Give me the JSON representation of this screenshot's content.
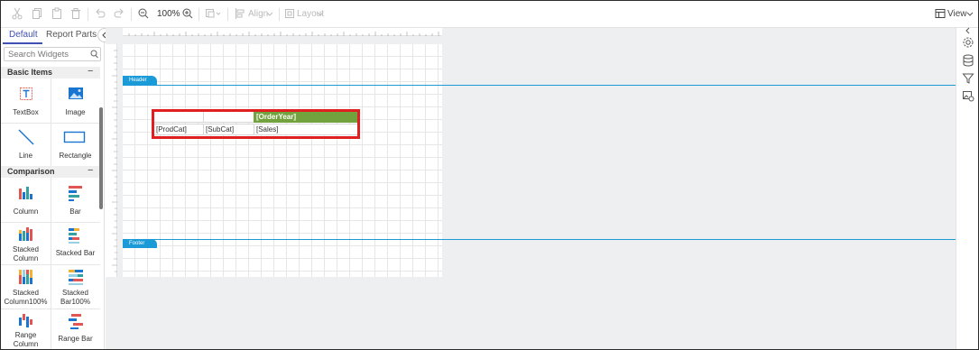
{
  "toolbar": {
    "cut_icon": "scissors-icon",
    "copy_icon": "copy-icon",
    "paste_icon": "paste-icon",
    "delete_icon": "trash-icon",
    "undo_icon": "undo-icon",
    "redo_icon": "redo-icon",
    "zoom_out_icon": "zoom-out-icon",
    "zoom_level": "100%",
    "zoom_in_icon": "zoom-in-icon",
    "align_label": "Align",
    "layout_label": "Layout",
    "view_label": "View"
  },
  "panel": {
    "tabs": [
      {
        "label": "Default",
        "active": true
      },
      {
        "label": "Report Parts",
        "active": false
      }
    ],
    "search": {
      "placeholder": "Search Widgets"
    },
    "sections": [
      {
        "title": "Basic Items",
        "toggle": "−",
        "items": [
          {
            "label": "TextBox",
            "icon": "textbox-icon"
          },
          {
            "label": "Image",
            "icon": "image-icon"
          },
          {
            "label": "Line",
            "icon": "line-icon"
          },
          {
            "label": "Rectangle",
            "icon": "rectangle-icon"
          }
        ]
      },
      {
        "title": "Comparison",
        "toggle": "−",
        "items": [
          {
            "label": "Column",
            "icon": "column-chart-icon"
          },
          {
            "label": "Bar",
            "icon": "bar-chart-icon"
          },
          {
            "label_line1": "Stacked",
            "label_line2": "Column",
            "icon": "stacked-column-icon"
          },
          {
            "label": "Stacked Bar",
            "icon": "stacked-bar-icon"
          },
          {
            "label_line1": "Stacked",
            "label_line2": "Column100%",
            "icon": "stacked-column-100-icon"
          },
          {
            "label_line1": "Stacked",
            "label_line2": "Bar100%",
            "icon": "stacked-bar-100-icon"
          },
          {
            "label_line1": "Range",
            "label_line2": "Column",
            "icon": "range-column-icon"
          },
          {
            "label": "Range Bar",
            "icon": "range-bar-icon"
          }
        ]
      }
    ]
  },
  "report": {
    "header_label": "Header",
    "footer_label": "Footer",
    "tablix": {
      "column_group": "[OrderYear]",
      "row_cells": [
        "[ProdCat]",
        "[SubCat]",
        "[Sales]"
      ]
    }
  },
  "rail": {
    "icons": [
      "settings-icon",
      "database-icon",
      "filter-icon",
      "image-properties-icon"
    ]
  },
  "colors": {
    "accent": "#3f51b5",
    "band": "#1a9bd7",
    "header_cell": "#72a23d",
    "selection": "#e02020"
  }
}
